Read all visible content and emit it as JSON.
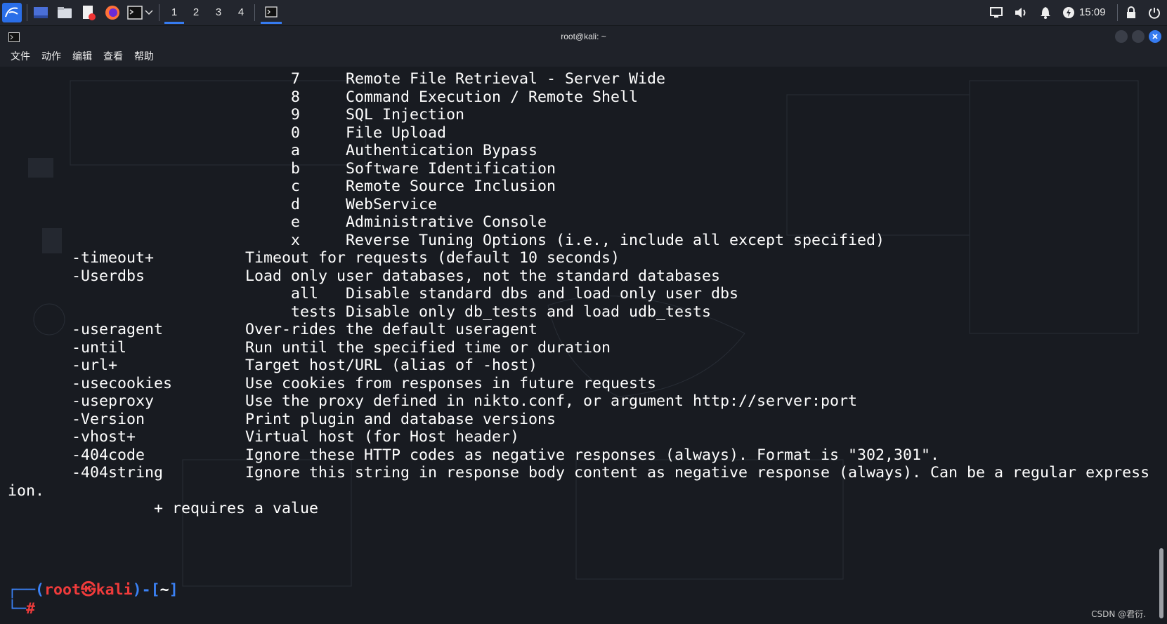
{
  "taskbar": {
    "workspaces": [
      "1",
      "2",
      "3",
      "4"
    ],
    "active_workspace": "1",
    "clock": "15:09",
    "accent": "#367bf0"
  },
  "window": {
    "title": "root@kali: ~"
  },
  "menu": [
    "文件",
    "动作",
    "编辑",
    "查看",
    "帮助"
  ],
  "terminal": {
    "lines": [
      "                               7     Remote File Retrieval - Server Wide",
      "                               8     Command Execution / Remote Shell",
      "                               9     SQL Injection",
      "                               0     File Upload",
      "                               a     Authentication Bypass",
      "                               b     Software Identification",
      "                               c     Remote Source Inclusion",
      "                               d     WebService",
      "                               e     Administrative Console",
      "                               x     Reverse Tuning Options (i.e., include all except specified)",
      "       -timeout+          Timeout for requests (default 10 seconds)",
      "       -Userdbs           Load only user databases, not the standard databases",
      "                               all   Disable standard dbs and load only user dbs",
      "                               tests Disable only db_tests and load udb_tests",
      "       -useragent         Over-rides the default useragent",
      "       -until             Run until the specified time or duration",
      "       -url+              Target host/URL (alias of -host)",
      "       -usecookies        Use cookies from responses in future requests",
      "       -useproxy          Use the proxy defined in nikto.conf, or argument http://server:port",
      "       -Version           Print plugin and database versions",
      "       -vhost+            Virtual host (for Host header)",
      "       -404code           Ignore these HTTP codes as negative responses (always). Format is \"302,301\".",
      "       -404string         Ignore this string in response body content as negative response (always). Can be a regular express",
      "ion.",
      "                + requires a value",
      "",
      ""
    ],
    "prompt": {
      "corner_top": "┌──(",
      "user": "root",
      "skull": "㉿",
      "host": "kali",
      "mid": ")-[",
      "dir": "~",
      "end": "]",
      "corner_bottom": "└─",
      "hash": "#"
    }
  },
  "watermark": "CSDN @君衍."
}
